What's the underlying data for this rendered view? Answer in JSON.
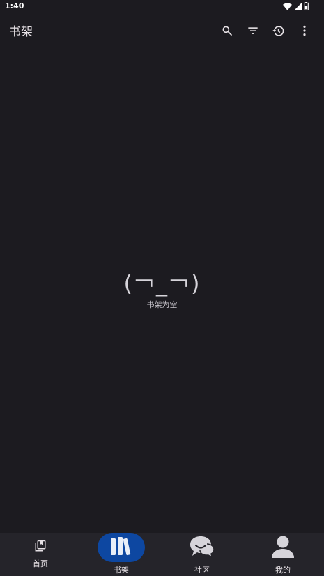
{
  "status_bar": {
    "time": "1:40",
    "icons": [
      "wifi-icon",
      "signal-icon",
      "battery-icon"
    ]
  },
  "app_bar": {
    "title": "书架",
    "actions": [
      "search-icon",
      "filter-icon",
      "history-icon",
      "more-vert-icon"
    ]
  },
  "empty_state": {
    "face": "(￢_￢)",
    "message": "书架为空"
  },
  "bottom_nav": {
    "items": [
      {
        "label": "首页",
        "icon": "home-books-icon",
        "selected": false
      },
      {
        "label": "书架",
        "icon": "bookshelf-icon",
        "selected": true
      },
      {
        "label": "社区",
        "icon": "community-chat-icon",
        "selected": false
      },
      {
        "label": "我的",
        "icon": "person-icon",
        "selected": false
      }
    ]
  },
  "colors": {
    "background": "#1c1b20",
    "nav_background": "#25242a",
    "selected_indicator": "#0d47a1",
    "text": "#e6e1e5"
  }
}
